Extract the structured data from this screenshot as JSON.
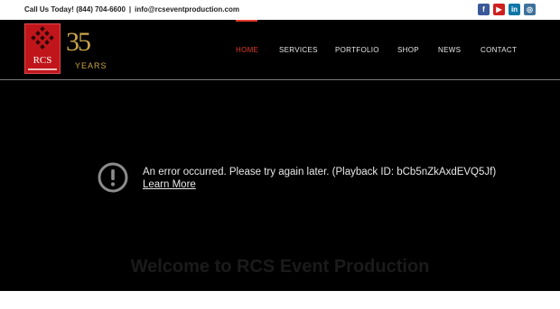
{
  "topbar": {
    "phone_text": "Call Us Today! (844) 704-6600",
    "separator": "|",
    "email_text": "info@rcseventproduction.com",
    "social": [
      {
        "icon": "facebook-icon",
        "glyph": "f",
        "color": "#3b5998"
      },
      {
        "icon": "youtube-icon",
        "glyph": "▶",
        "color": "#cd201f"
      },
      {
        "icon": "linkedin-icon",
        "glyph": "in",
        "color": "#0e76a8"
      },
      {
        "icon": "instagram-icon",
        "glyph": "◎",
        "color": "#3f729b"
      }
    ]
  },
  "logo": {
    "brand": "RCS",
    "years_number": "35",
    "years_label": "YEARS"
  },
  "nav": {
    "items": [
      {
        "label": "HOME",
        "active": true
      },
      {
        "label": "SERVICES",
        "active": false
      },
      {
        "label": "PORTFOLIO",
        "active": false
      },
      {
        "label": "SHOP",
        "active": false
      },
      {
        "label": "NEWS",
        "active": false
      },
      {
        "label": "CONTACT",
        "active": false
      }
    ],
    "accent_color": "#e33b2b"
  },
  "video": {
    "error_message": "An error occurred. Please try again later. (Playback ID: bCb5nZkAxdEVQ5Jf)",
    "learn_more": "Learn More",
    "error_icon": "alert-circle-icon"
  },
  "hero": {
    "heading": "Welcome to RCS Event Production"
  }
}
